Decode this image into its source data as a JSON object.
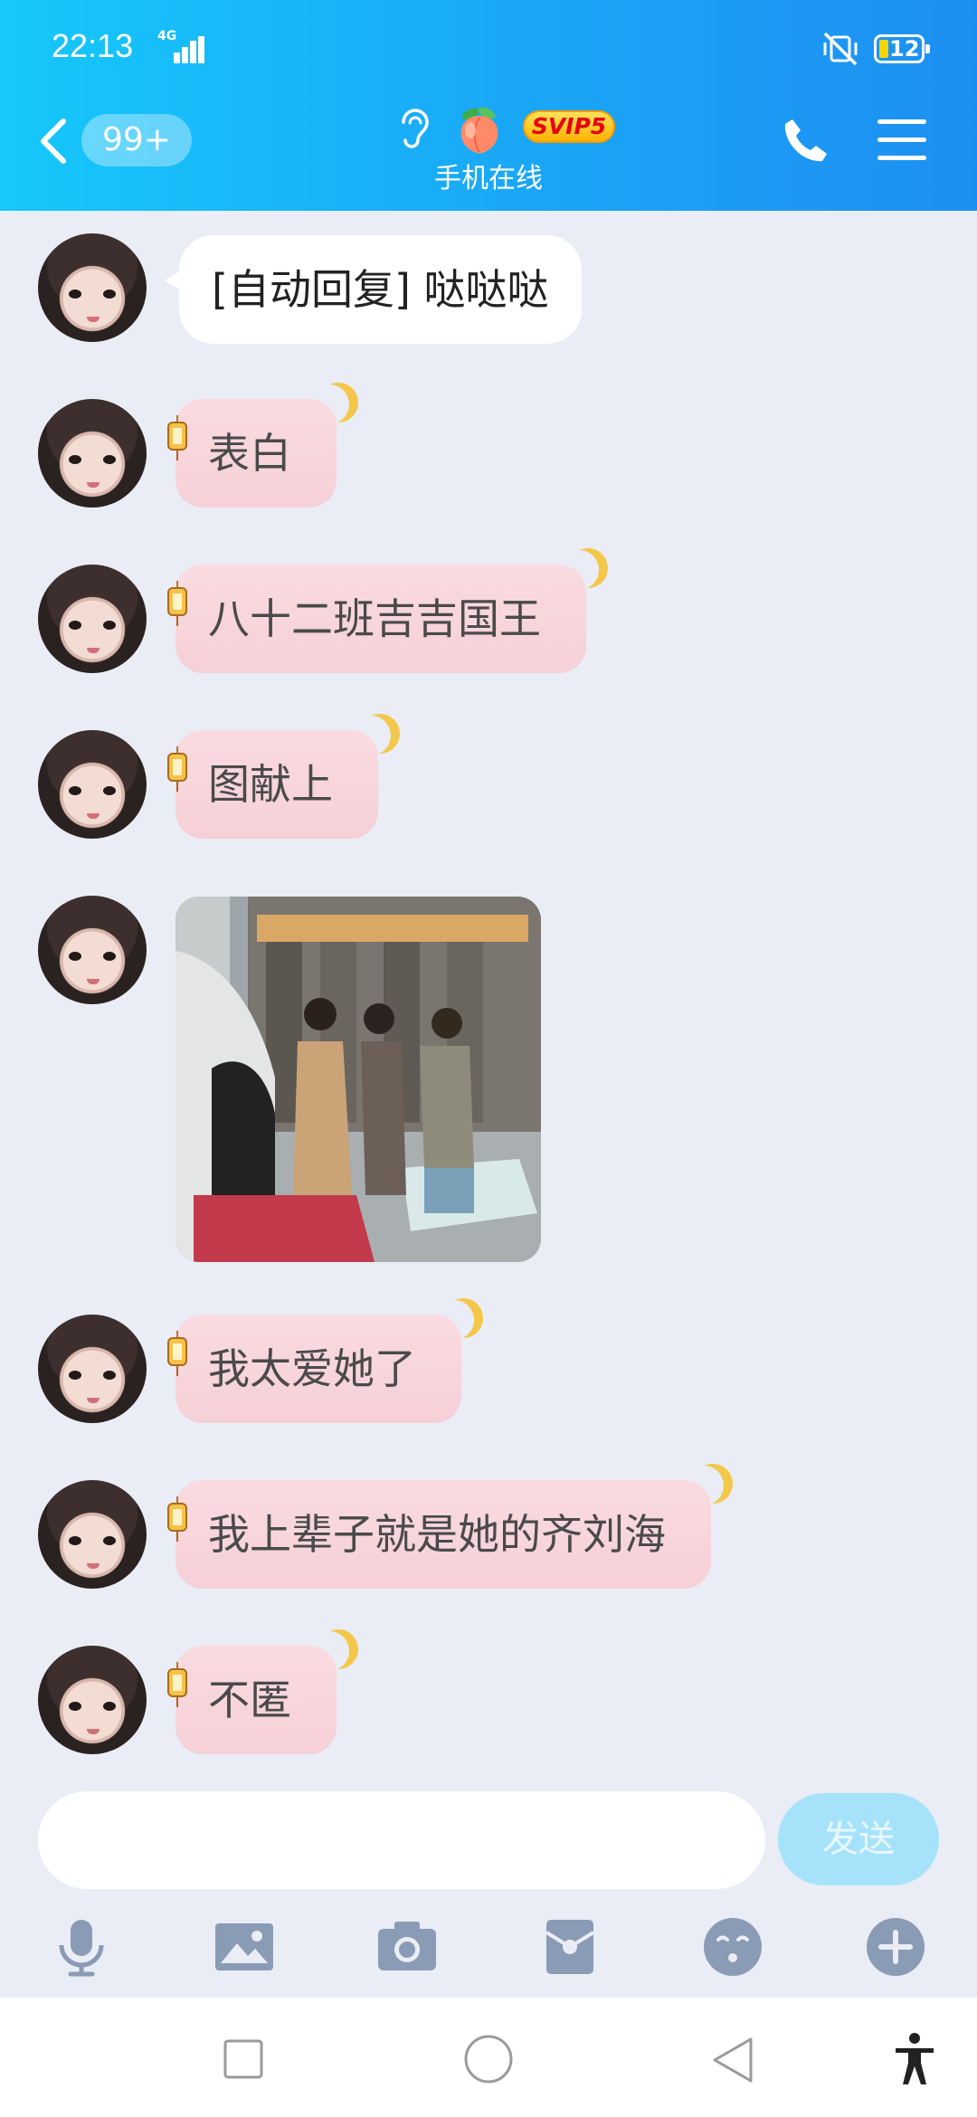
{
  "status_bar": {
    "time": "22:13",
    "network": "4G",
    "battery_level": "12"
  },
  "header": {
    "unread_count": "99+",
    "vip_badge": "SVIP5",
    "online_status": "手机在线"
  },
  "messages": [
    {
      "type": "text",
      "style": "white",
      "text": "[自动回复] 哒哒哒"
    },
    {
      "type": "text",
      "style": "pink",
      "text": "表白"
    },
    {
      "type": "text",
      "style": "pink",
      "text": "八十二班吉吉国王"
    },
    {
      "type": "text",
      "style": "pink",
      "text": "图献上"
    },
    {
      "type": "image"
    },
    {
      "type": "text",
      "style": "pink",
      "text": "我太爱她了"
    },
    {
      "type": "text",
      "style": "pink",
      "text": "我上辈子就是她的齐刘海"
    },
    {
      "type": "text",
      "style": "pink",
      "text": "不匿"
    }
  ],
  "input": {
    "placeholder": "",
    "send_label": "发送"
  },
  "toolbar": [
    "mic-icon",
    "image-icon",
    "camera-icon",
    "red-packet-icon",
    "emoji-icon",
    "plus-icon"
  ],
  "navbar": [
    "recent-apps-icon",
    "home-icon",
    "back-icon",
    "accessibility-icon"
  ]
}
